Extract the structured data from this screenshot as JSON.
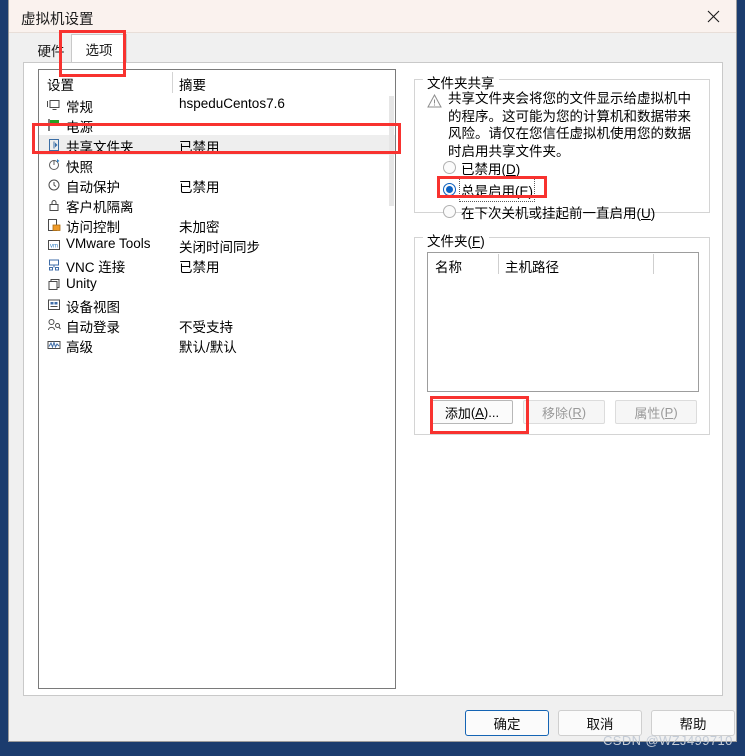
{
  "window": {
    "title": "虚拟机设置",
    "close_icon": "close-icon"
  },
  "tabs": [
    {
      "label": "硬件",
      "active": false
    },
    {
      "label": "选项",
      "active": true
    }
  ],
  "settings_list": {
    "headers": [
      "设置",
      "摘要"
    ],
    "rows": [
      {
        "icon": "monitor-icon",
        "label": "常规",
        "summary": "hspeduCentos7.6",
        "selected": false
      },
      {
        "icon": "power-flag-icon",
        "label": "电源",
        "summary": "",
        "selected": false
      },
      {
        "icon": "shared-folder-icon",
        "label": "共享文件夹",
        "summary": "已禁用",
        "selected": true
      },
      {
        "icon": "snapshot-icon",
        "label": "快照",
        "summary": "",
        "selected": false
      },
      {
        "icon": "clock-icon",
        "label": "自动保护",
        "summary": "已禁用",
        "selected": false
      },
      {
        "icon": "lock-icon",
        "label": "客户机隔离",
        "summary": "",
        "selected": false
      },
      {
        "icon": "access-lock-icon",
        "label": "访问控制",
        "summary": "未加密",
        "selected": false
      },
      {
        "icon": "vmware-tools-icon",
        "label": "VMware Tools",
        "summary": "关闭时间同步",
        "selected": false
      },
      {
        "icon": "vnc-icon",
        "label": "VNC 连接",
        "summary": "已禁用",
        "selected": false
      },
      {
        "icon": "unity-icon",
        "label": "Unity",
        "summary": "",
        "selected": false
      },
      {
        "icon": "device-view-icon",
        "label": "设备视图",
        "summary": "",
        "selected": false
      },
      {
        "icon": "auto-login-icon",
        "label": "自动登录",
        "summary": "不受支持",
        "selected": false
      },
      {
        "icon": "advanced-icon",
        "label": "高级",
        "summary": "默认/默认",
        "selected": false
      }
    ]
  },
  "folder_sharing": {
    "group_title": "文件夹共享",
    "warning_icon": "warning-triangle-icon",
    "warning_text": "共享文件夹会将您的文件显示给虚拟机中的程序。这可能为您的计算机和数据带来风险。请仅在您信任虚拟机使用您的数据时启用共享文件夹。",
    "options": [
      {
        "label": "已禁用",
        "accel": "D",
        "checked": false
      },
      {
        "label": "总是启用",
        "accel": "E",
        "checked": true
      },
      {
        "label": "在下次关机或挂起前一直启用",
        "accel": "U",
        "checked": false
      }
    ]
  },
  "folders": {
    "group_title": "文件夹",
    "group_accel": "F",
    "columns": [
      "名称",
      "主机路径"
    ],
    "rows": [],
    "buttons": [
      {
        "label": "添加",
        "accel": "A",
        "suffix": "...",
        "enabled": true,
        "highlighted": true
      },
      {
        "label": "移除",
        "accel": "R",
        "suffix": "",
        "enabled": false,
        "highlighted": false
      },
      {
        "label": "属性",
        "accel": "P",
        "suffix": "",
        "enabled": false,
        "highlighted": false
      }
    ]
  },
  "dialog_buttons": {
    "ok": "确定",
    "cancel": "取消",
    "help": "帮助"
  },
  "watermark": "CSDN @WZJ499710",
  "colors": {
    "accent": "#0b62c4",
    "annotation": "#f8322f",
    "titlebar": "#faf2ee",
    "window_frame": "#1b3c6e",
    "selected_row": "#eeeeee"
  }
}
